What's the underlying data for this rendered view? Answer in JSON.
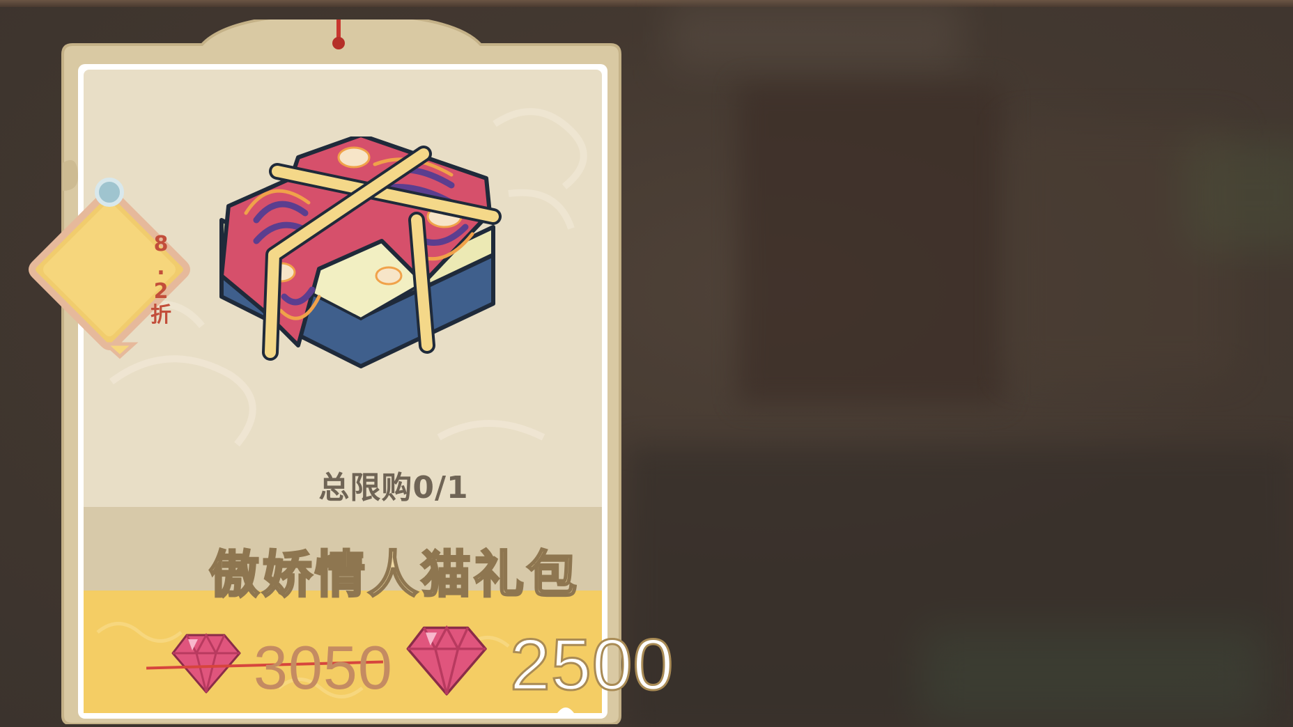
{
  "product": {
    "purchase_limit": "总限购0/1",
    "name": "傲娇情人猫礼包",
    "discount_badge": {
      "number": "8",
      "dot": ".",
      "decimal": "2",
      "unit": "折"
    },
    "original_price": "3050",
    "sale_price": "2500"
  },
  "icons": {
    "currency": "ruby-gem-icon",
    "item": "gift-box-icon",
    "badge": "discount-tag-icon"
  },
  "colors": {
    "price_bar": "#f4cd64",
    "card_frame": "#d9c9a3",
    "card_inner": "#e8dec6",
    "gem": "#e0557d",
    "strike": "#d6453d"
  }
}
